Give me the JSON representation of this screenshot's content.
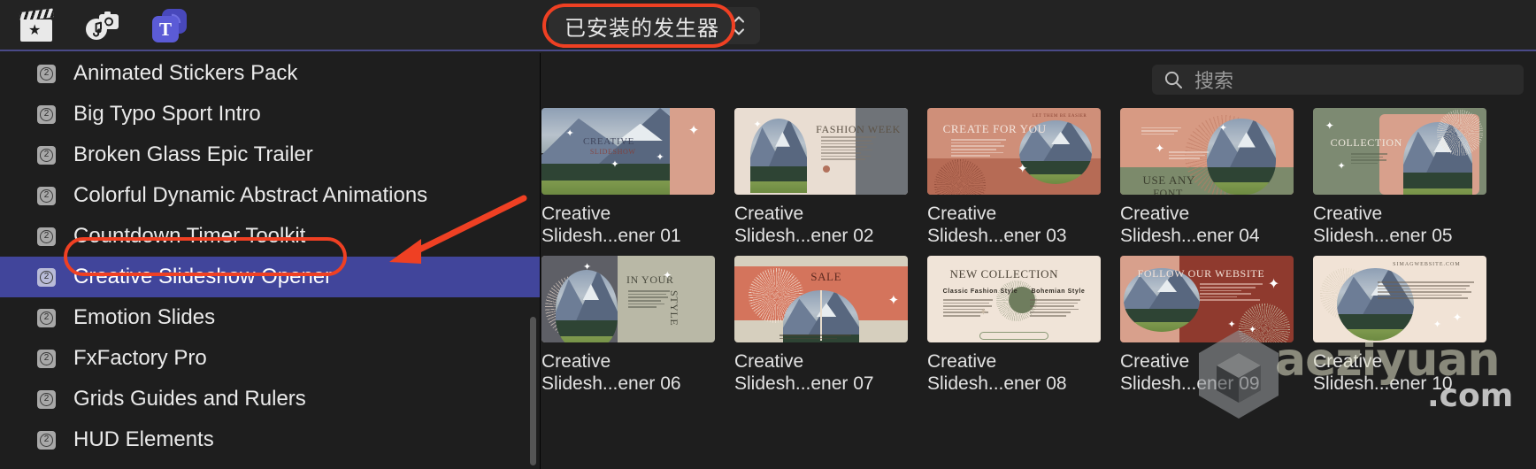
{
  "header": {
    "icons": [
      {
        "name": "clapperboard-icon",
        "label": "Titles and Generators"
      },
      {
        "name": "photos-audio-icon",
        "label": "Photos and Audio"
      },
      {
        "name": "titles-generators-icon",
        "label": "Titles"
      }
    ],
    "popup": {
      "label": "已安装的发生器",
      "stepper_icon": "up-down-chevron-icon",
      "highlight_color": "#ef4023"
    }
  },
  "sidebar": {
    "items": [
      {
        "label": "Animated Stickers Pack",
        "badge": "2",
        "selected": false
      },
      {
        "label": "Big Typo Sport Intro",
        "badge": "2",
        "selected": false
      },
      {
        "label": "Broken Glass Epic Trailer",
        "badge": "2",
        "selected": false
      },
      {
        "label": "Colorful Dynamic Abstract Animations",
        "badge": "2",
        "selected": false
      },
      {
        "label": "Countdown Timer Toolkit",
        "badge": "2",
        "selected": false
      },
      {
        "label": "Creative Slideshow Opener",
        "badge": "2",
        "selected": true
      },
      {
        "label": "Emotion Slides",
        "badge": "2",
        "selected": false
      },
      {
        "label": "FxFactory Pro",
        "badge": "2",
        "selected": false
      },
      {
        "label": "Grids Guides and Rulers",
        "badge": "2",
        "selected": false
      },
      {
        "label": "HUD Elements",
        "badge": "2",
        "selected": false
      }
    ],
    "selection_color": "#41459b"
  },
  "search": {
    "placeholder": "搜索",
    "icon": "search-icon",
    "value": ""
  },
  "grid": {
    "rows": [
      [
        {
          "caption_line1": "Creative",
          "caption_line2": "Slidesh...ener 01",
          "style": "mountain-peach-panel",
          "art_text": "CREATIVE"
        },
        {
          "caption_line1": "Creative",
          "caption_line2": "Slidesh...ener 02",
          "style": "beige-arch",
          "art_text": "FASHION WEEK"
        },
        {
          "caption_line1": "Creative",
          "caption_line2": "Slidesh...ener 03",
          "style": "terracotta-circle",
          "art_text": "CREATE FOR YOU"
        },
        {
          "caption_line1": "Creative",
          "caption_line2": "Slidesh...ener 04",
          "style": "salmon-sage-split",
          "art_text": "USE ANY FONT"
        },
        {
          "caption_line1": "Creative",
          "caption_line2": "Slidesh...ener 05",
          "style": "sage-collection",
          "art_text": "COLLECTION"
        }
      ],
      [
        {
          "caption_line1": "Creative",
          "caption_line2": "Slidesh...ener 06",
          "style": "grey-olive-split",
          "art_text": "IN YOUR STYLE"
        },
        {
          "caption_line1": "Creative",
          "caption_line2": "Slidesh...ener 07",
          "style": "coral-sale",
          "art_text": "SALE"
        },
        {
          "caption_line1": "Creative",
          "caption_line2": "Slidesh...ener 08",
          "style": "cream-new-collection",
          "art_text": "NEW COLLECTION"
        },
        {
          "caption_line1": "Creative",
          "caption_line2": "Slidesh...ener 09",
          "style": "darkred-follow",
          "art_text": "FOLLOW OUR WEBSITE"
        },
        {
          "caption_line1": "Creative",
          "caption_line2": "Slidesh...ener 10",
          "style": "cream-website",
          "art_text": "SIMAGWEBSITE.COM"
        }
      ]
    ],
    "art_subtexts": {
      "t03_small": "LET THEM BE EASIER",
      "t08_left_title": "Classic Fashion Style",
      "t08_right_title": "Bohemian Style"
    }
  },
  "watermark": {
    "text": "aeziyuan",
    "suffix": ".com",
    "logo": "cube-logo"
  }
}
